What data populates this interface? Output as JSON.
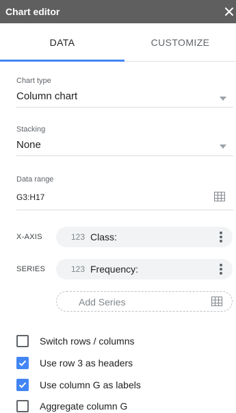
{
  "header": {
    "title": "Chart editor",
    "close_icon": "close-icon"
  },
  "tabs": [
    {
      "label": "DATA",
      "active": true
    },
    {
      "label": "CUSTOMIZE",
      "active": false
    }
  ],
  "chart_type": {
    "label": "Chart type",
    "value": "Column chart"
  },
  "stacking": {
    "label": "Stacking",
    "value": "None"
  },
  "data_range": {
    "label": "Data range",
    "value": "G3:H17"
  },
  "x_axis": {
    "label": "X-AXIS",
    "chip": {
      "num": "123",
      "name": "Class:"
    }
  },
  "series": {
    "label": "SERIES",
    "chips": [
      {
        "num": "123",
        "name": "Frequency:"
      }
    ],
    "add_label": "Add Series"
  },
  "options": [
    {
      "label": "Switch rows / columns",
      "checked": false
    },
    {
      "label": "Use row 3 as headers",
      "checked": true
    },
    {
      "label": "Use column G as labels",
      "checked": true
    },
    {
      "label": "Aggregate column G",
      "checked": false
    }
  ],
  "colors": {
    "accent": "#4285f4",
    "titlebar": "#5f5f5f"
  }
}
